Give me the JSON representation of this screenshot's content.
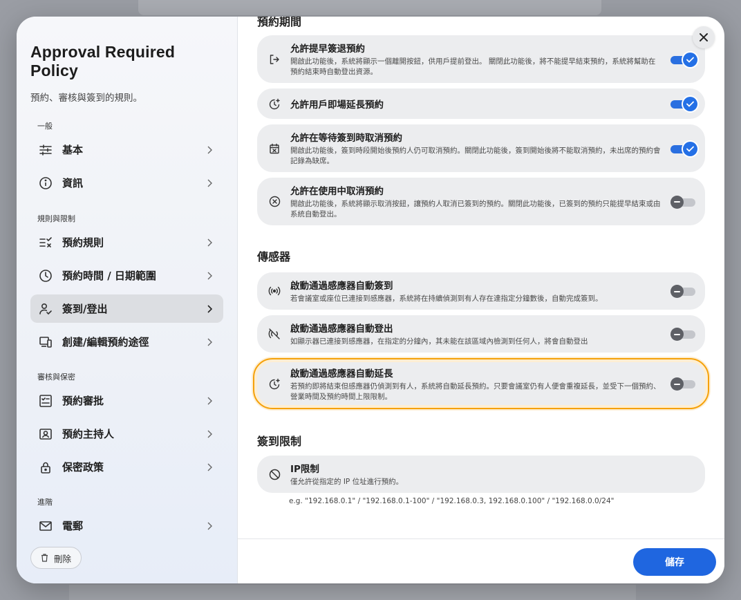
{
  "sidebar": {
    "title": "Approval Required Policy",
    "subtitle": "預約、審核與簽到的規則。",
    "sections": {
      "general": "一般",
      "rules": "規則與限制",
      "review": "審核與保密",
      "advanced": "進階"
    },
    "items": {
      "basic": "基本",
      "info": "資訊",
      "booking_rules": "預約規則",
      "time_range": "預約時間 / 日期範圍",
      "checkin": "簽到/登出",
      "create_edit": "創建/編輯預約途徑",
      "approval": "預約審批",
      "host": "預約主持人",
      "privacy": "保密政策",
      "email": "電郵"
    },
    "delete_label": "刪除",
    "active_item": "checkin"
  },
  "main": {
    "period_title": "預約期間",
    "rows": [
      {
        "title": "允許提早簽退預約",
        "desc": "開啟此功能後，系統將顯示一個離開按鈕，供用戶提前登出。 關閉此功能後，將不能提早結束預約，系統將幫助在預約結束時自動登出資源。",
        "on": true,
        "icon": "logout-icon"
      },
      {
        "title": "允許用戶即場延長預約",
        "desc": "",
        "on": true,
        "icon": "extend-time-icon"
      },
      {
        "title": "允許在等待簽到時取消預約",
        "desc": "開啟此功能後，簽到時段開始後預約人仍可取消預約。關閉此功能後，簽到開始後將不能取消預約，未出席的預約會記錄為缺席。",
        "on": true,
        "icon": "calendar-cancel-icon"
      },
      {
        "title": "允許在使用中取消預約",
        "desc": "開啟此功能後，系統將顯示取消按鈕，讓預約人取消已簽到的預約。關閉此功能後，已簽到的預約只能提早結束或由系統自動登出。",
        "on": false,
        "icon": "cancel-circle-icon"
      }
    ],
    "sensor_title": "傳感器",
    "sensor_rows": [
      {
        "title": "啟動通過感應器自動簽到",
        "desc": "若會議室或座位已連接到感應器，系統將在持續偵測到有人存在達指定分鐘數後，自動完成簽到。",
        "on": false,
        "icon": "sensor-icon"
      },
      {
        "title": "啟動通過感應器自動登出",
        "desc": "如顯示器已連接到感應器，在指定的分鐘內，其未能在該區域內檢測到任何人，將會自動登出",
        "on": false,
        "icon": "sensor-off-icon"
      },
      {
        "title": "啟動通過感應器自動延長",
        "desc": "若預約即將結束但感應器仍偵測到有人，系統將自動延長預約。只要會議室仍有人便會重複延長，並受下一個預約、營業時間及預約時間上限限制。",
        "on": false,
        "icon": "extend-time-icon"
      }
    ],
    "checkin_limit_title": "簽到限制",
    "ip": {
      "title": "IP限制",
      "desc": "僅允許從指定的 IP 位址進行預約。",
      "hint": "e.g. \"192.168.0.1\" / \"192.168.0.1-100\" / \"192.168.0.3, 192.168.0.100\" / \"192.168.0.0/24\""
    },
    "save_label": "儲存"
  },
  "colors": {
    "accent": "#1f66e0",
    "highlight": "#f5a10a",
    "row_bg": "#ecedef"
  }
}
